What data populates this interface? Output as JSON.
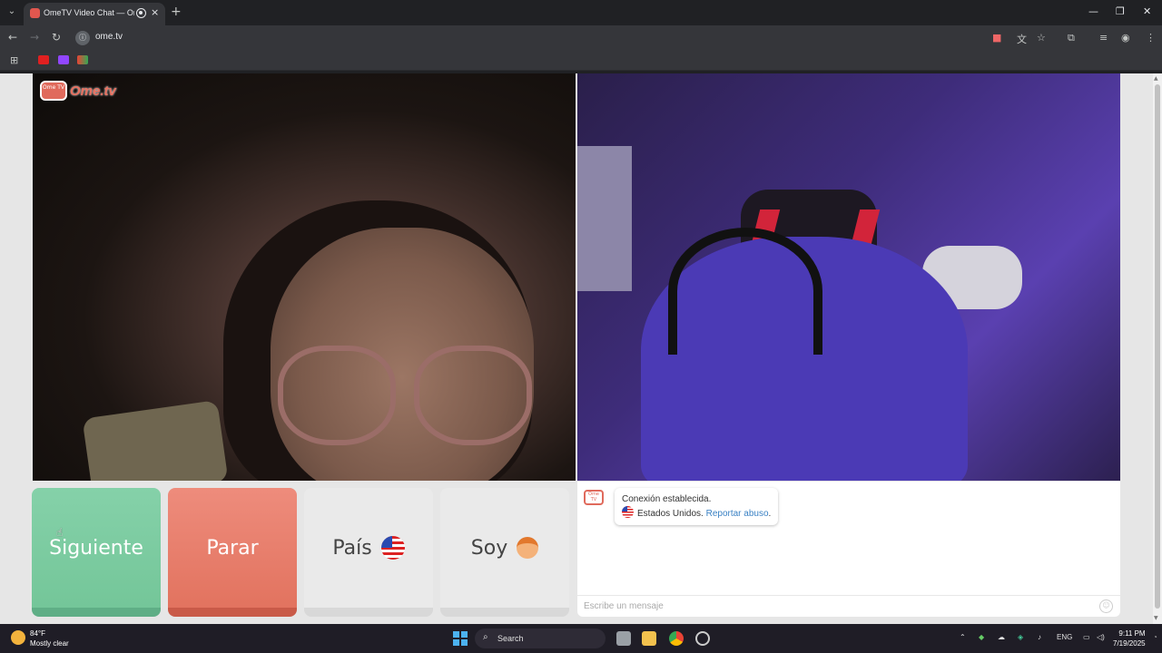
{
  "browser": {
    "tab_title": "OmeTV Video Chat — Ome",
    "url": "ome.tv",
    "new_tab_glyph": "+",
    "close_glyph": "×"
  },
  "page": {
    "logo_text": "Ome.tv",
    "logo_badge": "Ome TV",
    "buttons": {
      "next": "Siguiente",
      "stop": "Parar",
      "country": "País",
      "gender": "Soy"
    },
    "chat": {
      "connection": "Conexión establecida.",
      "country_name": "Estados Unidos.",
      "report_link": "Reportar abuso",
      "report_suffix": ".",
      "input_placeholder": "Escribe un mensaje"
    }
  },
  "taskbar": {
    "temperature": "84°F",
    "weather": "Mostly clear",
    "search_label": "Search",
    "language": "ENG",
    "time": "9:11 PM",
    "date": "7/19/2025"
  },
  "colors": {
    "next": "#74c699",
    "stop": "#e2735f",
    "brand": "#e06a5c",
    "link": "#3b82c4"
  }
}
